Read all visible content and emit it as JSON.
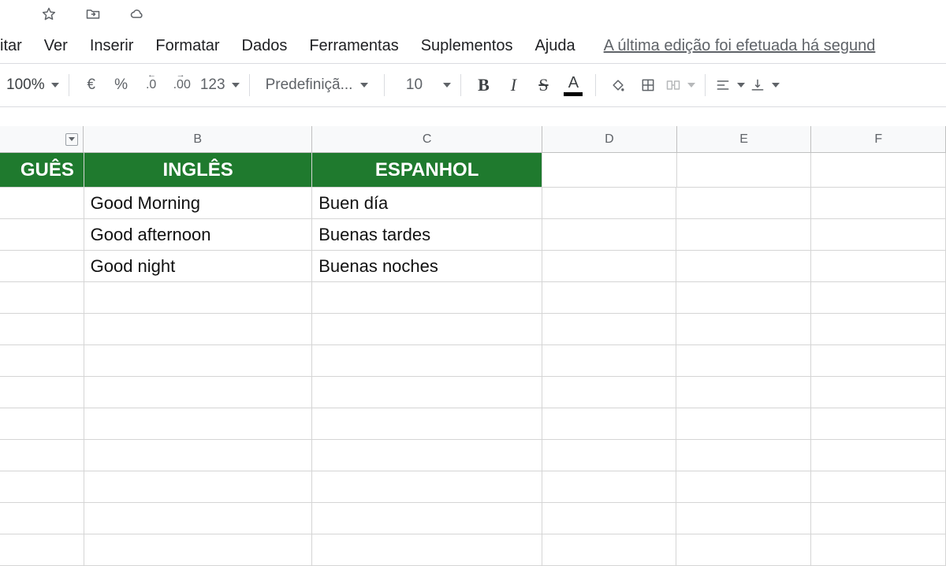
{
  "titlebar": {
    "star_icon": "star-icon",
    "move_icon": "move-to-folder-icon",
    "cloud_icon": "cloud-saved-icon"
  },
  "menubar": {
    "items": [
      "itar",
      "Ver",
      "Inserir",
      "Formatar",
      "Dados",
      "Ferramentas",
      "Suplementos",
      "Ajuda"
    ],
    "last_edit": "A última edição foi efetuada há segund"
  },
  "toolbar": {
    "zoom": "100%",
    "currency": "€",
    "percent": "%",
    "dec_dec": ".0",
    "inc_dec": ".00",
    "more_formats": "123",
    "font": "Predefiniçã...",
    "font_size": "10",
    "bold": "B",
    "italic": "I",
    "strike": "S",
    "text_color_glyph": "A"
  },
  "sheet": {
    "columns": [
      "",
      "B",
      "C",
      "D",
      "E",
      "F"
    ],
    "header_row": [
      "GUÊS",
      "INGLÊS",
      "ESPANHOL"
    ],
    "data": [
      [
        "",
        "Good Morning",
        "Buen día",
        "",
        "",
        ""
      ],
      [
        "",
        "Good afternoon",
        "Buenas tardes",
        "",
        "",
        ""
      ],
      [
        "",
        "Good night",
        "Buenas noches",
        "",
        "",
        ""
      ]
    ],
    "empty_rows": 9
  },
  "colors": {
    "header_bg": "#1f7a2e"
  },
  "chart_data": {
    "type": "table",
    "columns": [
      "PORTUGUÊS (partial: GUÊS)",
      "INGLÊS",
      "ESPANHOL"
    ],
    "rows": [
      [
        "",
        "Good Morning",
        "Buen día"
      ],
      [
        "",
        "Good afternoon",
        "Buenas tardes"
      ],
      [
        "",
        "Good night",
        "Buenas noches"
      ]
    ]
  }
}
